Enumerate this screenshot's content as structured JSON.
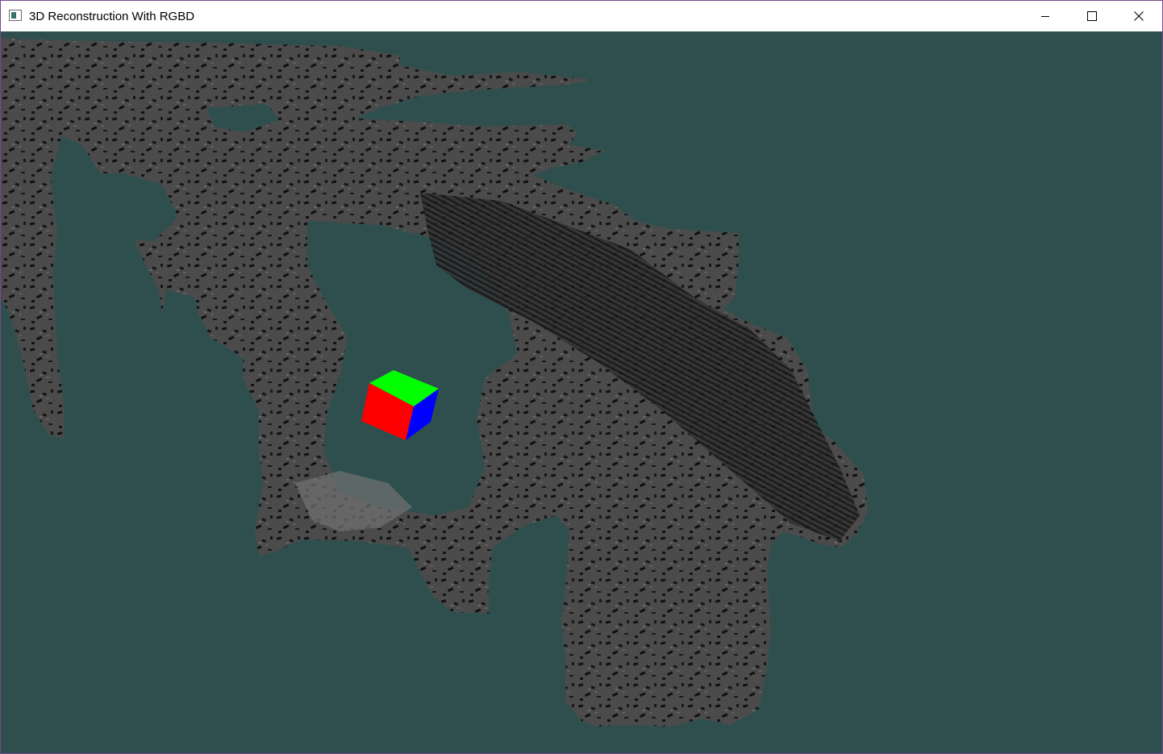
{
  "window": {
    "title": "3D Reconstruction With RGBD",
    "app_icon": "window-app-icon",
    "controls": [
      {
        "name": "minimize-button",
        "icon": "minimize-icon"
      },
      {
        "name": "maximize-button",
        "icon": "maximize-icon"
      },
      {
        "name": "close-button",
        "icon": "close-icon"
      }
    ]
  },
  "scene": {
    "background_color": "#2f4f4f",
    "mesh_color": "#4a4a4a",
    "cube": {
      "top_face_color": "#00ff00",
      "front_face_color": "#ff0000",
      "side_face_color": "#0000ff"
    }
  }
}
